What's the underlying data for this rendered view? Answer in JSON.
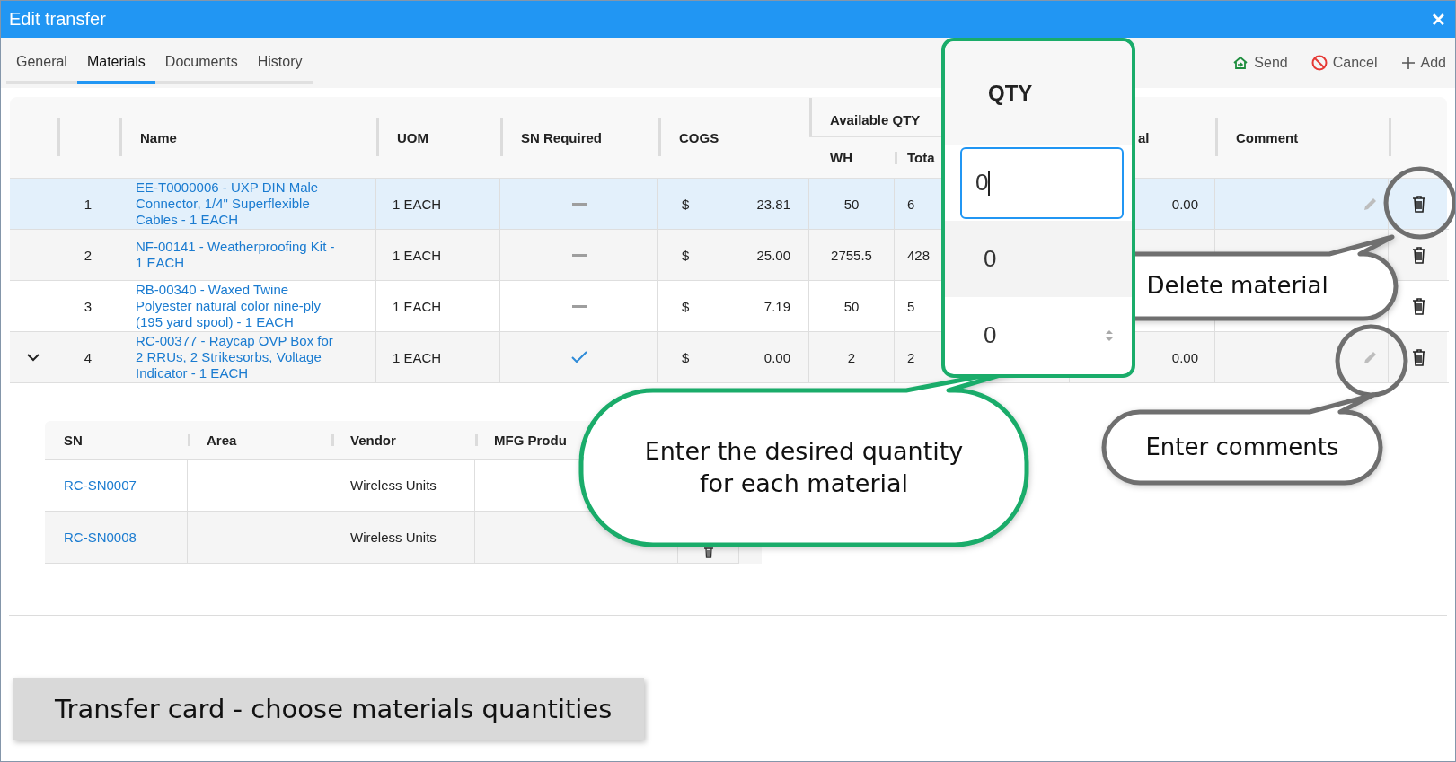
{
  "window": {
    "title": "Edit transfer",
    "close": "✕"
  },
  "tabs": [
    {
      "label": "General",
      "selected": false
    },
    {
      "label": "Materials",
      "selected": true
    },
    {
      "label": "Documents",
      "selected": false
    },
    {
      "label": "History",
      "selected": false
    }
  ],
  "toolbar": [
    {
      "kind": "send",
      "label": "Send"
    },
    {
      "kind": "cancel",
      "label": "Cancel"
    },
    {
      "kind": "add",
      "label": "Add"
    }
  ],
  "table": {
    "headers": {
      "name": "Name",
      "uom": "UOM",
      "sn_required": "SN Required",
      "cogs": "COGS",
      "available_qty": "Available QTY",
      "wh": "WH",
      "total": "Tota",
      "column_9": "al",
      "comment": "Comment"
    },
    "rows": [
      {
        "index": "1",
        "name": "EE-T0000006 - UXP DIN Male Connector, 1/4\" Superflexible Cables - 1 EACH",
        "uom": "1 EACH",
        "sn_required": false,
        "currency": "$",
        "cogs": "23.81",
        "wh": "50",
        "total": "6",
        "column_9": "0.00",
        "edit_icon": true,
        "selected": true,
        "expanded": false
      },
      {
        "index": "2",
        "name": "NF-00141 - Weatherproofing Kit - 1 EACH",
        "uom": "1 EACH",
        "sn_required": false,
        "currency": "$",
        "cogs": "25.00",
        "wh": "2755.5",
        "total": "428",
        "edit_icon": false,
        "selected": false,
        "expanded": false
      },
      {
        "index": "3",
        "name": "RB-00340 - Waxed Twine Polyester natural color nine-ply (195 yard spool) - 1 EACH",
        "uom": "1 EACH",
        "sn_required": false,
        "currency": "$",
        "cogs": "7.19",
        "wh": "50",
        "total": "5",
        "edit_icon": false,
        "selected": false,
        "expanded": false
      },
      {
        "index": "4",
        "name": "RC-00377 - Raycap OVP Box for 2 RRUs, 2 Strikesorbs, Voltage Indicator - 1 EACH",
        "uom": "1 EACH",
        "sn_required": true,
        "currency": "$",
        "cogs": "0.00",
        "wh": "2",
        "total": "2",
        "column_9": "0.00",
        "edit_icon": true,
        "selected": false,
        "expanded": true
      }
    ]
  },
  "serials": {
    "headers": [
      "SN",
      "Area",
      "Vendor",
      "MFG Produ"
    ],
    "rows": [
      {
        "sn": "RC-SN0007",
        "vendor": "Wireless Units"
      },
      {
        "sn": "RC-SN0008",
        "vendor": "Wireless Units",
        "icon": true
      }
    ]
  },
  "qty_zoom": {
    "header": "QTY",
    "rows": [
      {
        "value": "0",
        "focused": true,
        "spinner": false
      },
      {
        "value": "0",
        "focused": false,
        "spinner": false
      },
      {
        "value": "0",
        "focused": false,
        "spinner": true
      }
    ]
  },
  "callouts": [
    {
      "kind": "quantity",
      "color": "#1aac6a",
      "text": "Enter the desired quantity for each material"
    },
    {
      "kind": "delete",
      "color": "#6f6f6f",
      "text": "Delete material"
    },
    {
      "kind": "comments",
      "color": "#6f6f6f",
      "text": "Enter comments"
    }
  ],
  "caption": "Transfer card - choose materials quantities"
}
